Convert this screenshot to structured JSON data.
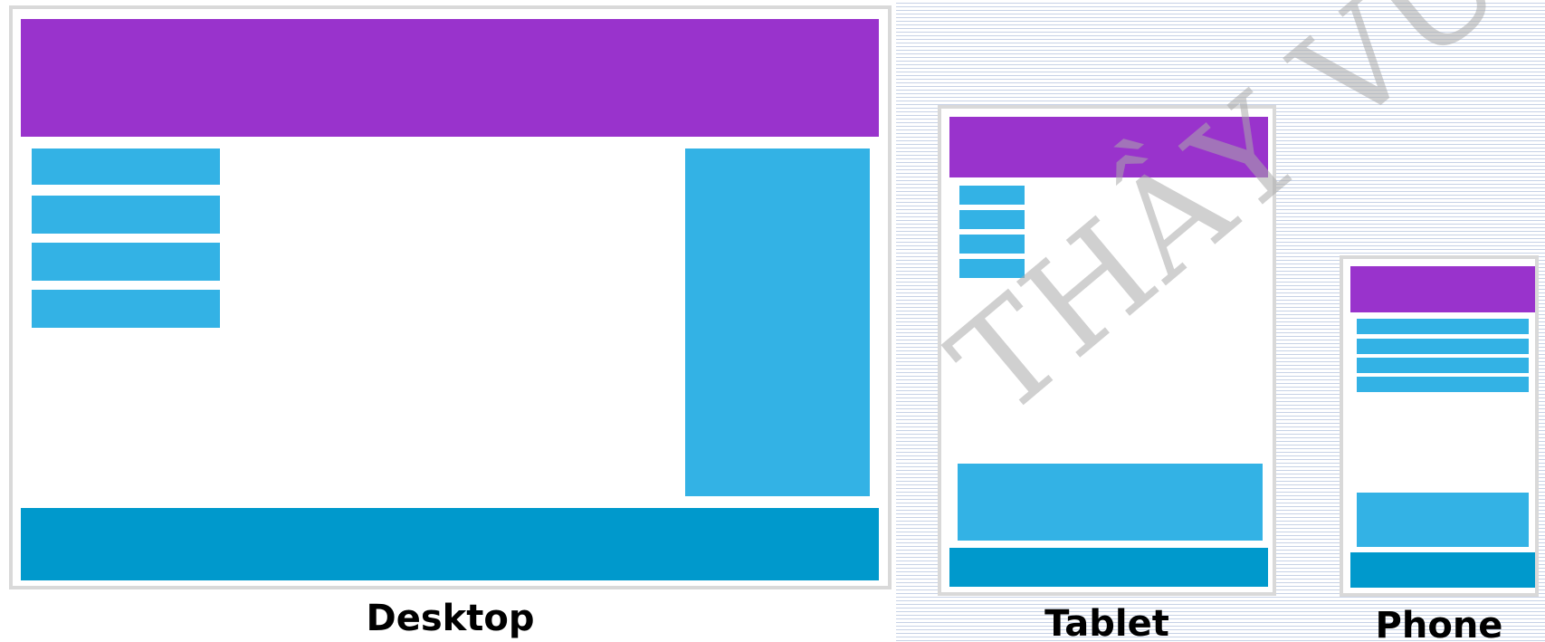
{
  "labels": {
    "desktop": "Desktop",
    "tablet": "Tablet",
    "phone": "Phone"
  },
  "watermark": "THẦY VU",
  "colors": {
    "header": "#9933cc",
    "nav_and_sidebar": "#33b2e5",
    "footer": "#0099cc",
    "frame_border": "#d9d9d9"
  }
}
